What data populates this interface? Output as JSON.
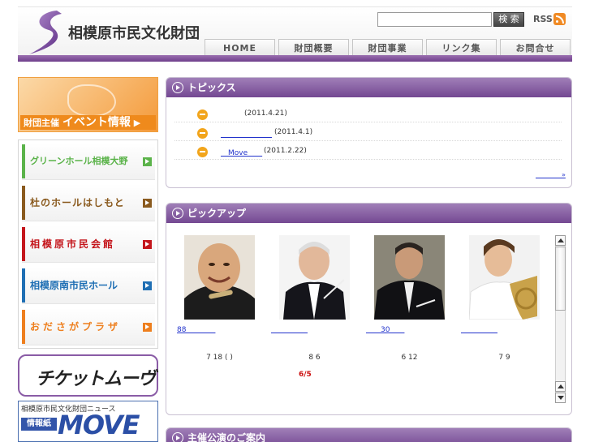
{
  "header": {
    "site_title": "相模原市民文化財団",
    "search_placeholder": "",
    "search_button": "検 索",
    "rss_label": "RSS",
    "nav": [
      "HOME",
      "財団概要",
      "財団事業",
      "リンク集",
      "お問合せ"
    ]
  },
  "sidebar": {
    "event_banner": {
      "small": "財団主催",
      "big": "イベント情報"
    },
    "halls": [
      {
        "name": "グリーンホール相模大野",
        "color": "#5bb34a"
      },
      {
        "name": "杜のホールはしもと",
        "color": "#8a5a1e"
      },
      {
        "name": "相模原市民会館",
        "color": "#c4161c"
      },
      {
        "name": "相模原南市民ホール",
        "color": "#1f6fb4"
      },
      {
        "name": "おださがプラザ",
        "color": "#ee7f1e"
      }
    ],
    "ticket_label": "チケットムーヴ",
    "news_banner": {
      "top": "相模原市民文化財団ニュース",
      "joho": "情報紙",
      "move": "MOVE"
    }
  },
  "topics": {
    "title": "トピックス",
    "items": [
      {
        "link": "",
        "date": "(2011.4.21)"
      },
      {
        "link": "　　　　　　　",
        "date": "(2011.4.1)"
      },
      {
        "link": "　Move　　",
        "date": "(2011.2.22)"
      }
    ],
    "more": "　　　　»"
  },
  "pickup": {
    "title": "ピックアップ",
    "items": [
      {
        "link": "88　　　　",
        "date": "7 18 (  )"
      },
      {
        "link": "　　　　　",
        "date": "8 6"
      },
      {
        "link": "　　30　　",
        "date": "6 12"
      },
      {
        "link": "　　　　　",
        "date": "7 9"
      }
    ],
    "red_note": "6/5"
  },
  "shusai": {
    "title": "主催公演のご案内"
  }
}
